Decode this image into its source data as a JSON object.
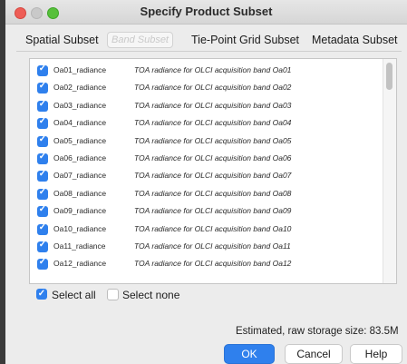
{
  "window": {
    "title": "Specify Product Subset"
  },
  "tabs": [
    {
      "label": "Spatial Subset"
    },
    {
      "label": "Band Subset"
    },
    {
      "label": "Tie-Point Grid Subset"
    },
    {
      "label": "Metadata Subset"
    }
  ],
  "bands": [
    {
      "name": "Oa01_radiance",
      "desc": "TOA radiance for OLCI acquisition band Oa01",
      "checked": true
    },
    {
      "name": "Oa02_radiance",
      "desc": "TOA radiance for OLCI acquisition band Oa02",
      "checked": true
    },
    {
      "name": "Oa03_radiance",
      "desc": "TOA radiance for OLCI acquisition band Oa03",
      "checked": true
    },
    {
      "name": "Oa04_radiance",
      "desc": "TOA radiance for OLCI acquisition band Oa04",
      "checked": true
    },
    {
      "name": "Oa05_radiance",
      "desc": "TOA radiance for OLCI acquisition band Oa05",
      "checked": true
    },
    {
      "name": "Oa06_radiance",
      "desc": "TOA radiance for OLCI acquisition band Oa06",
      "checked": true
    },
    {
      "name": "Oa07_radiance",
      "desc": "TOA radiance for OLCI acquisition band Oa07",
      "checked": true
    },
    {
      "name": "Oa08_radiance",
      "desc": "TOA radiance for OLCI acquisition band Oa08",
      "checked": true
    },
    {
      "name": "Oa09_radiance",
      "desc": "TOA radiance for OLCI acquisition band Oa09",
      "checked": true
    },
    {
      "name": "Oa10_radiance",
      "desc": "TOA radiance for OLCI acquisition band Oa10",
      "checked": true
    },
    {
      "name": "Oa11_radiance",
      "desc": "TOA radiance for OLCI acquisition band Oa11",
      "checked": true
    },
    {
      "name": "Oa12_radiance",
      "desc": "TOA radiance for OLCI acquisition band Oa12",
      "checked": true
    }
  ],
  "selection": {
    "select_all": "Select all",
    "select_all_checked": true,
    "select_none": "Select none"
  },
  "storage": {
    "text": "Estimated, raw storage size: 83.5M"
  },
  "buttons": {
    "ok": "OK",
    "cancel": "Cancel",
    "help": "Help"
  },
  "icons": {
    "checkbox_checked": "checkmark-icon"
  },
  "colors": {
    "accent": "#2f80ed",
    "close": "#ee5d56",
    "zoom": "#57c03b"
  }
}
